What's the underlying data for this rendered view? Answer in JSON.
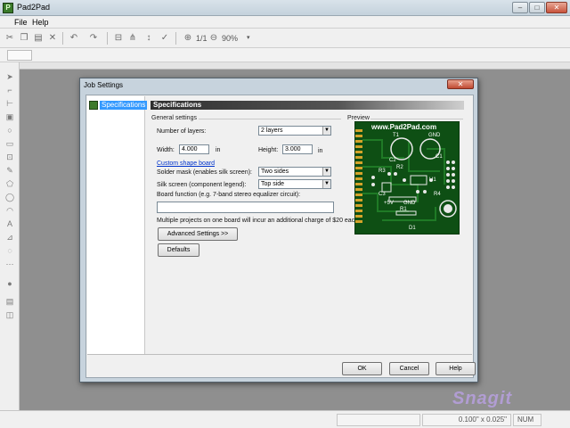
{
  "app": {
    "title": "Pad2Pad",
    "icon": "pad2pad-icon"
  },
  "window_buttons": {
    "min": "–",
    "max": "□",
    "close": "✕"
  },
  "menu": [
    {
      "label": "File"
    },
    {
      "label": "Help"
    }
  ],
  "toolbar": {
    "zoom_page": "1/1",
    "zoom_level": "90%"
  },
  "dialog": {
    "title": "Job Settings",
    "close": "✕",
    "nav": {
      "item": "Specifications"
    },
    "section_title": "Specifications",
    "general_settings_label": "General settings",
    "preview_label": "Preview",
    "layers": {
      "label": "Number of layers:",
      "value": "2 layers"
    },
    "width": {
      "label": "Width:",
      "value": "4.000",
      "unit": "in"
    },
    "height": {
      "label": "Height:",
      "value": "3.000",
      "unit": "in"
    },
    "custom_shape_link": "Custom shape board",
    "solder_mask": {
      "label": "Solder mask (enables silk screen):",
      "value": "Two sides"
    },
    "silk_screen": {
      "label": "Silk screen (component legend):",
      "value": "Top side"
    },
    "board_function": {
      "label": "Board function (e.g. 7-band stereo equalizer circuit):",
      "value": ""
    },
    "note": "Multiple projects on one board will incur an additional charge of $20 each.",
    "advanced_button": "Advanced Settings >>",
    "defaults_button": "Defaults",
    "ok_button": "OK",
    "cancel_button": "Cancel",
    "help_button": "Help",
    "board_preview": {
      "url": "www.Pad2Pad.com",
      "labels": [
        "GND",
        "T1",
        "C1",
        "C2",
        "R2",
        "R3",
        "U1",
        "R4",
        "C3",
        "+5V",
        "GND",
        "R1",
        "D1"
      ]
    }
  },
  "status": {
    "coords": "0.100\" x 0.025\"",
    "num": "NUM"
  },
  "watermark": "Snagit"
}
